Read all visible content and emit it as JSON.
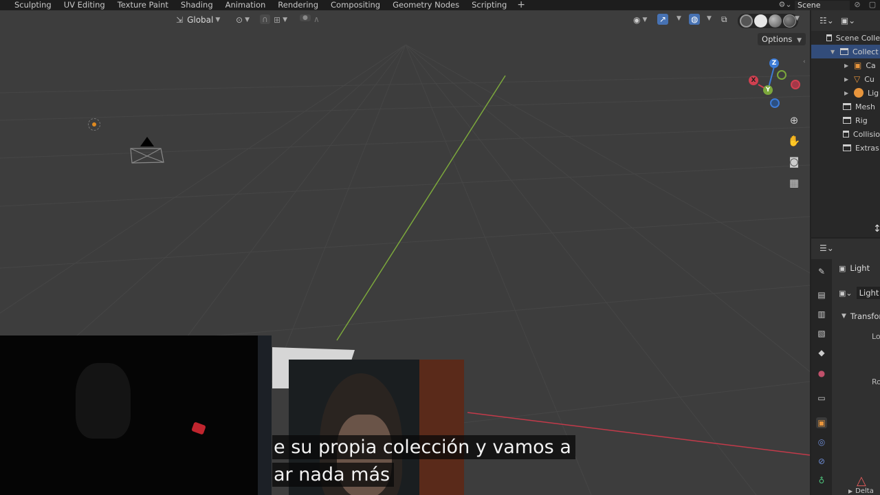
{
  "workspaces": [
    "Sculpting",
    "UV Editing",
    "Texture Paint",
    "Shading",
    "Animation",
    "Rendering",
    "Compositing",
    "Geometry Nodes",
    "Scripting"
  ],
  "add_workspace_icon": "plus-icon",
  "scene": {
    "name": "Scene"
  },
  "viewport_header": {
    "orientation": "Global",
    "options_label": "Options"
  },
  "outliner": {
    "rows": [
      {
        "label": "Scene Colle",
        "icon": "scene-collection-icon"
      },
      {
        "label": "Collect",
        "icon": "collection-icon",
        "selected": true
      },
      {
        "label": "Ca",
        "icon": "camera-object-icon"
      },
      {
        "label": "Cu",
        "icon": "mesh-object-icon"
      },
      {
        "label": "Lig",
        "icon": "light-object-icon"
      },
      {
        "label": "Mesh",
        "icon": "collection-icon"
      },
      {
        "label": "Rig",
        "icon": "collection-icon"
      },
      {
        "label": "Collisio",
        "icon": "collection-icon"
      },
      {
        "label": "Extras",
        "icon": "collection-icon"
      }
    ]
  },
  "properties": {
    "object_name": "Light",
    "datablock_name": "Light",
    "section": "Transfor",
    "field_location": "Lo",
    "field_rotation": "Ro",
    "footer_label": "Delta"
  },
  "caption": {
    "line1": "e su propia colección y vamos a",
    "line2": "ar nada más"
  },
  "colors": {
    "viewport_bg": "#3d3d3d",
    "selection": "#324c7a",
    "x_axis": "#d04050",
    "y_axis": "#7ca83c",
    "z_axis": "#3d7bd6"
  }
}
